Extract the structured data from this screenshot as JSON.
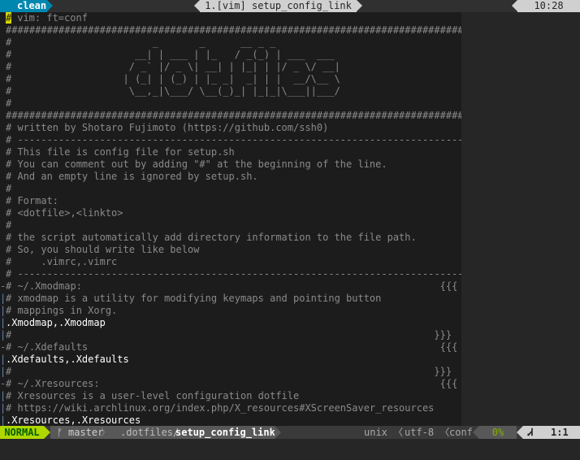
{
  "tabline": {
    "mode_label": "clean",
    "title": "1.[vim] setup_config_link",
    "clock": "10:28"
  },
  "editor": {
    "lines": [
      {
        "fold": "",
        "text": "# vim: ft=conf",
        "cls": "comment",
        "cursor": true
      },
      {
        "fold": "",
        "text": "###############################################################################",
        "cls": "comment"
      },
      {
        "fold": "",
        "text": "#                        _       _      __ _ _                                #",
        "cls": "comment"
      },
      {
        "fold": "",
        "text": "#                     __| | ___ | |_   / _(_) | ___  ___                      #",
        "cls": "comment"
      },
      {
        "fold": "",
        "text": "#                    / _` |/ _ \\| __| | |_| | |/ _ \\/ __|                     #",
        "cls": "comment"
      },
      {
        "fold": "",
        "text": "#                   | (_| | (_) | |_ _|  _| | |  __/\\__ \\                     #",
        "cls": "comment"
      },
      {
        "fold": "",
        "text": "#                    \\__,_|\\___/ \\__(_)_| |_|_|\\___||___/                     #",
        "cls": "comment"
      },
      {
        "fold": "",
        "text": "#                                                                             #",
        "cls": "comment"
      },
      {
        "fold": "",
        "text": "###############################################################################",
        "cls": "comment"
      },
      {
        "fold": "",
        "text": "# written by Shotaro Fujimoto (https://github.com/ssh0)",
        "cls": "comment"
      },
      {
        "fold": "",
        "text": "# -----------------------------------------------------------------------------",
        "cls": "comment"
      },
      {
        "fold": "",
        "text": "# This file is config file for setup.sh",
        "cls": "comment"
      },
      {
        "fold": "",
        "text": "# You can comment out by adding \"#\" at the beginning of the line.",
        "cls": "comment"
      },
      {
        "fold": "",
        "text": "# And an empty line is ignored by setup.sh.",
        "cls": "comment"
      },
      {
        "fold": "",
        "text": "#",
        "cls": "comment"
      },
      {
        "fold": "",
        "text": "# Format:",
        "cls": "comment"
      },
      {
        "fold": "",
        "text": "# <dotfile>,<linkto>",
        "cls": "comment"
      },
      {
        "fold": "",
        "text": "#",
        "cls": "comment"
      },
      {
        "fold": "",
        "text": "# the script automatically add directory information to the file path.",
        "cls": "comment"
      },
      {
        "fold": "",
        "text": "# So, you should write like below",
        "cls": "comment"
      },
      {
        "fold": "",
        "text": "#     .vimrc,.vimrc",
        "cls": "comment"
      },
      {
        "fold": "",
        "text": "# -----------------------------------------------------------------------------",
        "cls": "comment"
      },
      {
        "fold": "-",
        "text": "# ~/.Xmodmap:                                                             {{{",
        "cls": "comment"
      },
      {
        "fold": "|",
        "text": "# xmodmap is a utility for modifying keymaps and pointing button",
        "cls": "comment"
      },
      {
        "fold": "|",
        "text": "# mappings in Xorg.",
        "cls": "comment"
      },
      {
        "fold": "|",
        "text": ".Xmodmap,.Xmodmap",
        "cls": "code"
      },
      {
        "fold": "|",
        "text": "#                                                                        }}}",
        "cls": "comment"
      },
      {
        "fold": "-",
        "text": "# ~/.Xdefaults                                                            {{{",
        "cls": "comment"
      },
      {
        "fold": "|",
        "text": ".Xdefaults,.Xdefaults",
        "cls": "code"
      },
      {
        "fold": "|",
        "text": "#                                                                        }}}",
        "cls": "comment"
      },
      {
        "fold": "-",
        "text": "# ~/.Xresources:                                                          {{{",
        "cls": "comment"
      },
      {
        "fold": "|",
        "text": "# Xresources is a user-level configuration dotfile",
        "cls": "comment"
      },
      {
        "fold": "|",
        "text": "# https://wiki.archlinux.org/index.php/X_resources#XScreenSaver_resources",
        "cls": "comment"
      },
      {
        "fold": "|",
        "text": ".Xresources,.Xresources",
        "cls": "code"
      }
    ]
  },
  "statusline": {
    "mode": "NORMAL",
    "branch_icon": "ᚠ",
    "branch": "master",
    "separator": "〉",
    "path_dir": ".dotfiles/",
    "path_file": "setup_config_link",
    "fileformat": "unix 〈",
    "encoding": "utf-8 〈",
    "filetype": "conf",
    "percent": "0%",
    "line_icon": "Ꮧ",
    "position": "1:1"
  }
}
